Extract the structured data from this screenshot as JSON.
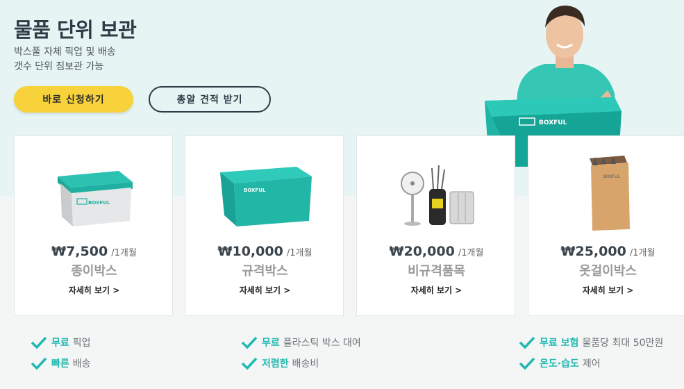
{
  "hero": {
    "title": "물품 단위 보관",
    "subtitle_line1": "박스풀 자체 픽업 및 배송",
    "subtitle_line2": "갯수 단위 짐보관 가능",
    "apply_button": "바로 신청하기",
    "quote_button": "총알 견적 받기",
    "box_brand": "BOXFUL"
  },
  "colors": {
    "accent_teal": "#1fb9b0",
    "button_yellow": "#f8d23a",
    "hero_bg": "#e6f4f4",
    "navy": "#2f3b46"
  },
  "products": [
    {
      "price": "₩7,500",
      "period": "/1개월",
      "name": "종이박스",
      "detail": "자세히 보기 >",
      "image": "paper-box"
    },
    {
      "price": "₩10,000",
      "period": "/1개월",
      "name": "규격박스",
      "detail": "자세히 보기 >",
      "image": "plastic-box"
    },
    {
      "price": "₩20,000",
      "period": "/1개월",
      "name": "비규격품목",
      "detail": "자세히 보기 >",
      "image": "irregular-items"
    },
    {
      "price": "₩25,000",
      "period": "/1개월",
      "name": "옷걸이박스",
      "detail": "자세히 보기 >",
      "image": "wardrobe-box"
    }
  ],
  "features": [
    {
      "highlight": "무료",
      "text": "픽업"
    },
    {
      "highlight": "빠른",
      "text": "배송"
    },
    {
      "highlight": "무료",
      "text": "플라스틱 박스 대여"
    },
    {
      "highlight": "저렴한",
      "text": "배송비"
    },
    {
      "highlight": "무료 보험",
      "text": "물품당 최대 50만원"
    },
    {
      "highlight": "온도·습도",
      "text": "제어"
    }
  ]
}
